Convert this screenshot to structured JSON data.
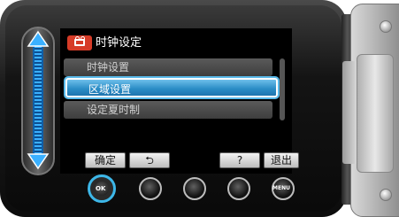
{
  "menu": {
    "title": "时钟设定",
    "items": [
      {
        "label": "时钟设置"
      },
      {
        "label": "区域设置"
      },
      {
        "label": "设定夏时制"
      }
    ]
  },
  "buttons": {
    "confirm_label": "确定",
    "back_label": "⮌",
    "help_label": "?",
    "exit_label": "退出"
  },
  "circles": {
    "ok_label": "OK",
    "menu_label": "MENU"
  },
  "colors": {
    "highlight": "#3db7e8",
    "title_icon": "#d63b27"
  },
  "icons": {
    "title": "camera-icon",
    "slider": "up-down-arrows-icon"
  }
}
